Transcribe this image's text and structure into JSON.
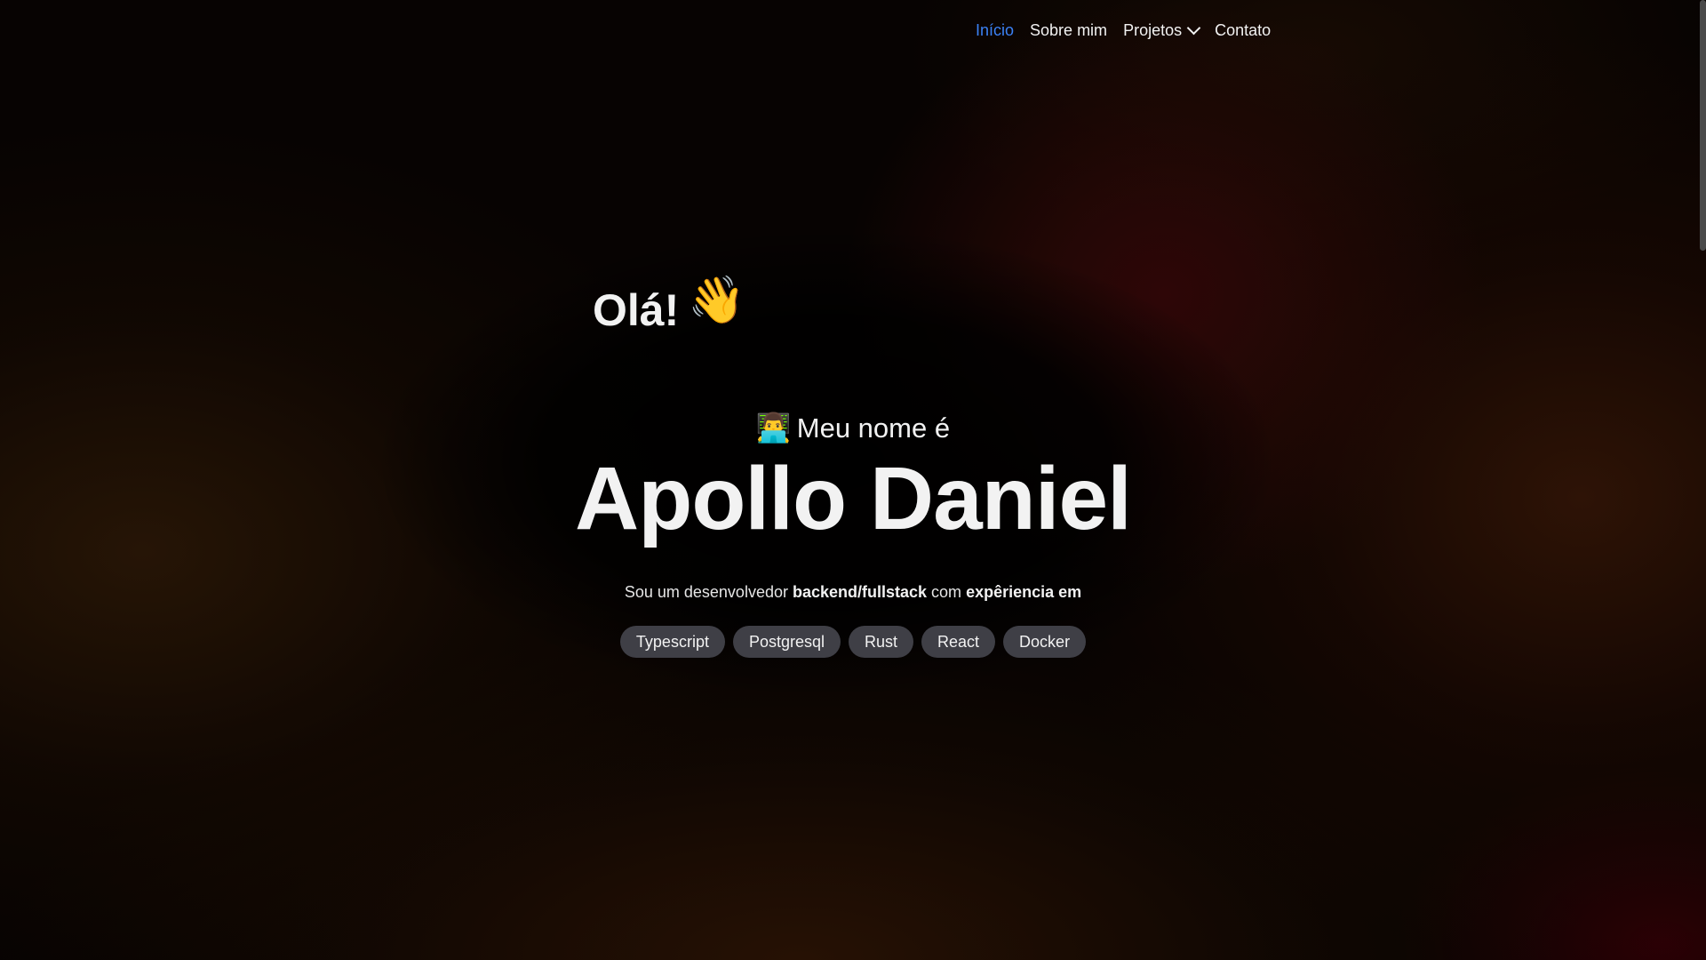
{
  "nav": {
    "items": [
      {
        "label": "Início",
        "active": true
      },
      {
        "label": "Sobre mim",
        "active": false
      },
      {
        "label": "Projetos",
        "active": false,
        "dropdown": true
      },
      {
        "label": "Contato",
        "active": false
      }
    ],
    "active_color": "#3b82f6"
  },
  "hero": {
    "greeting": "Olá!",
    "greeting_icon": "waving-hand-icon",
    "greeting_emoji": "👋",
    "intro_icon": "technologist-icon",
    "intro_emoji": "👨‍💻",
    "intro": "Meu nome é",
    "name": "Apollo Daniel",
    "bio": {
      "part1": "Sou um desenvolvedor ",
      "bold1": "backend/fullstack",
      "part2": " com ",
      "bold2": "expêriencia em"
    },
    "tags": [
      "Typescript",
      "Postgresql",
      "Rust",
      "React",
      "Docker"
    ]
  }
}
